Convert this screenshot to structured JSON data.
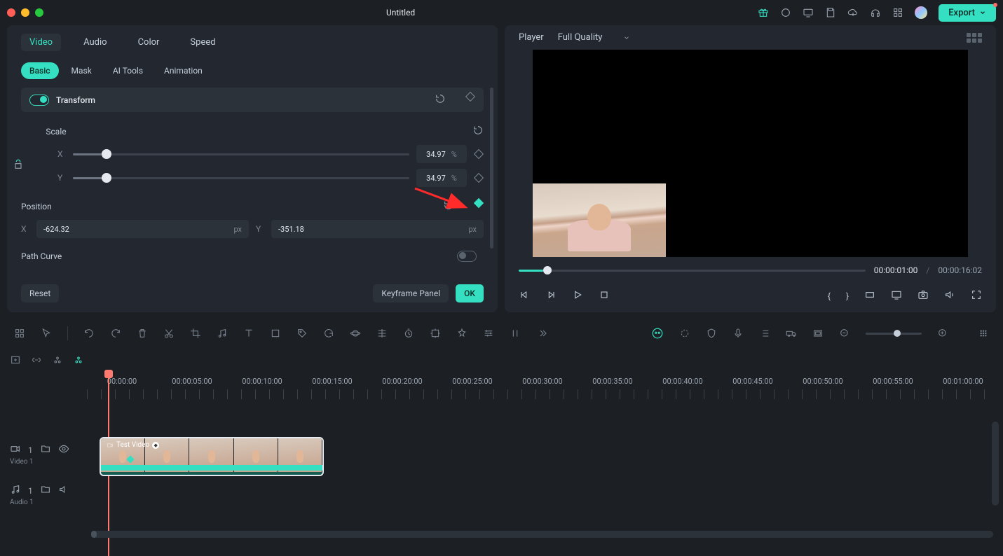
{
  "titlebar": {
    "title": "Untitled",
    "export_label": "Export"
  },
  "properties": {
    "tabs": [
      "Video",
      "Audio",
      "Color",
      "Speed"
    ],
    "active_tab": "Video",
    "subtabs": [
      "Basic",
      "Mask",
      "AI Tools",
      "Animation"
    ],
    "active_subtab": "Basic",
    "transform": {
      "label": "Transform",
      "scale_label": "Scale",
      "scale_x": "34.97",
      "scale_y": "34.97",
      "scale_unit": "%",
      "position_label": "Position",
      "pos_x": "-624.32",
      "pos_y": "-351.18",
      "pos_unit": "px",
      "path_curve_label": "Path Curve"
    },
    "footer": {
      "reset": "Reset",
      "keyframe_panel": "Keyframe Panel",
      "ok": "OK"
    }
  },
  "player": {
    "label": "Player",
    "quality": "Full Quality",
    "current_time": "00:00:01:00",
    "duration": "00:00:16:02"
  },
  "ruler": {
    "labels": [
      "00:00:00",
      "00:00:05:00",
      "00:00:10:00",
      "00:00:15:00",
      "00:00:20:00",
      "00:00:25:00",
      "00:00:30:00",
      "00:00:35:00",
      "00:00:40:00",
      "00:00:45:00",
      "00:00:50:00",
      "00:00:55:00",
      "00:01:00:00"
    ]
  },
  "tracks": {
    "video": {
      "name": "Video 1",
      "index": "1"
    },
    "audio": {
      "name": "Audio 1",
      "index": "1"
    }
  },
  "clip": {
    "label": "Test Video"
  },
  "axis": {
    "x": "X",
    "y": "Y"
  }
}
